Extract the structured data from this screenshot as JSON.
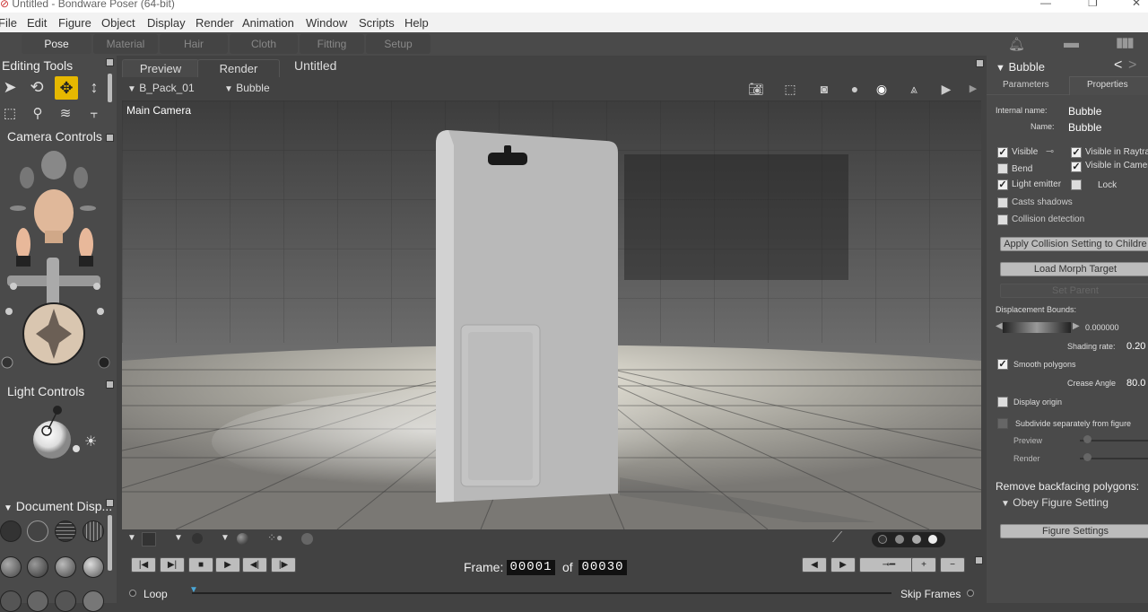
{
  "window": {
    "title": "Untitled - Bondware Poser (64-bit)"
  },
  "menu": [
    "File",
    "Edit",
    "Figure",
    "Object",
    "Display",
    "Render",
    "Animation",
    "Window",
    "Scripts",
    "Help"
  ],
  "rooms": [
    "Pose",
    "Material",
    "Hair",
    "Cloth",
    "Fitting",
    "Setup"
  ],
  "left": {
    "editing_tools": "Editing Tools",
    "camera_controls": "Camera Controls",
    "light_controls": "Light Controls",
    "document_display": "Document Disp..."
  },
  "view": {
    "tabs": [
      "Preview",
      "Render"
    ],
    "doc_title": "Untitled",
    "figure_select": "B_Pack_01",
    "actor_select": "Bubble",
    "camera_label": "Main Camera"
  },
  "timeline": {
    "frame_label": "Frame:",
    "frame_value": "00001",
    "of_label": "of",
    "frame_total": "00030",
    "loop_label": "Loop",
    "skip_frames_label": "Skip Frames"
  },
  "right": {
    "header": "Bubble",
    "tabs": [
      "Parameters",
      "Properties"
    ],
    "internal_name_label": "Internal name:",
    "internal_name": "Bubble",
    "name_label": "Name:",
    "name": "Bubble",
    "checks": {
      "visible": "Visible",
      "visible_raytrace": "Visible in Raytrac",
      "bend": "Bend",
      "visible_camera": "Visible in Camer",
      "light_emitter": "Light emitter",
      "lock": "Lock",
      "casts_shadows": "Casts shadows",
      "collision": "Collision detection",
      "smooth": "Smooth polygons",
      "display_origin": "Display origin",
      "subdivide": "Subdivide separately from figure"
    },
    "apply_collision": "Apply Collision Setting to Childre",
    "load_morph": "Load Morph Target",
    "set_parent": "Set Parent",
    "displacement_label": "Displacement Bounds:",
    "displacement_value": "0.000000",
    "shading_rate_label": "Shading rate:",
    "shading_rate": "0.20",
    "crease_angle_label": "Crease Angle",
    "crease_angle": "80.0",
    "preview_label": "Preview",
    "render_label": "Render",
    "backfacing_label": "Remove backfacing polygons:",
    "backfacing_option": "Obey Figure Setting",
    "figure_settings": "Figure Settings"
  },
  "colors": {
    "accent": "#e6b800",
    "panel": "#4a4a4a",
    "background": "#424242"
  }
}
